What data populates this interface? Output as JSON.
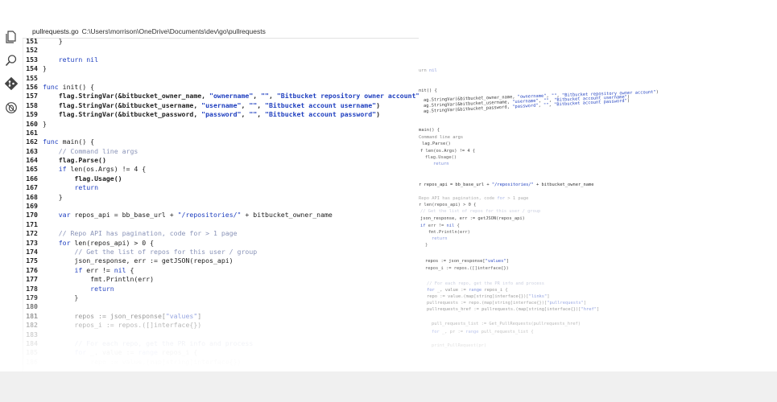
{
  "header": {
    "filename": "pullrequests.go",
    "path": "C:\\Users\\morrison\\OneDrive\\Documents\\dev\\go\\pullrequests"
  },
  "activity_bar": [
    "files-icon",
    "search-icon",
    "git-icon",
    "debug-icon"
  ],
  "colors": {
    "keyword": "#1f3fbf",
    "comment": "#8a94b8",
    "text": "#222222",
    "bottom_bar": "#f0f0f0"
  },
  "code_lines": [
    {
      "n": "151",
      "t": "    }"
    },
    {
      "n": "152",
      "t": ""
    },
    {
      "n": "153",
      "t": "    return nil"
    },
    {
      "n": "154",
      "t": "}"
    },
    {
      "n": "155",
      "t": ""
    },
    {
      "n": "156",
      "t": "func init() {"
    },
    {
      "n": "157",
      "t": "    flag.StringVar(&bitbucket_owner_name, \"ownername\", \"\", \"Bitbucket repository owner account\")"
    },
    {
      "n": "158",
      "t": "    flag.StringVar(&bitbucket_username, \"username\", \"\", \"Bitbucket account username\")"
    },
    {
      "n": "159",
      "t": "    flag.StringVar(&bitbucket_password, \"password\", \"\", \"Bitbucket account password\")"
    },
    {
      "n": "160",
      "t": "}"
    },
    {
      "n": "161",
      "t": ""
    },
    {
      "n": "162",
      "t": "func main() {"
    },
    {
      "n": "163",
      "t": "    // Command line args"
    },
    {
      "n": "164",
      "t": "    flag.Parse()"
    },
    {
      "n": "165",
      "t": "    if len(os.Args) != 4 {"
    },
    {
      "n": "166",
      "t": "        flag.Usage()"
    },
    {
      "n": "167",
      "t": "        return"
    },
    {
      "n": "168",
      "t": "    }"
    },
    {
      "n": "169",
      "t": ""
    },
    {
      "n": "170",
      "t": "    var repos_api = bb_base_url + \"/repositories/\" + bitbucket_owner_name"
    },
    {
      "n": "171",
      "t": ""
    },
    {
      "n": "172",
      "t": "    // Repo API has pagination, code for > 1 page"
    },
    {
      "n": "173",
      "t": "    for len(repos_api) > 0 {"
    },
    {
      "n": "174",
      "t": "        // Get the list of repos for this user / group"
    },
    {
      "n": "175",
      "t": "        json_response, err := getJSON(repos_api)"
    },
    {
      "n": "176",
      "t": "        if err != nil {"
    },
    {
      "n": "177",
      "t": "            fmt.Println(err)"
    },
    {
      "n": "178",
      "t": "            return"
    },
    {
      "n": "179",
      "t": "        }"
    },
    {
      "n": "180",
      "t": ""
    },
    {
      "n": "181",
      "t": "        repos := json_response[\"values\"]"
    },
    {
      "n": "182",
      "t": "        repos_i := repos.([]interface{})"
    },
    {
      "n": "183",
      "t": ""
    },
    {
      "n": "184",
      "t": "        // For each repo, get the PR info and process"
    },
    {
      "n": "185",
      "t": "        for _, value := range repos_i {"
    },
    {
      "n": "186",
      "t": "            repo := value.(map[string]interface{})"
    }
  ],
  "scattered_code": [
    "urn nil",
    "nit() {",
    "ag.StringVar(&bitbucket_owner_name, \"ownername\", \"\", \"Bitbucket repository owner account\")",
    "ag.StringVar(&bitbucket_username, \"username\", \"\", \"Bitbucket account username\")",
    "ag.StringVar(&bitbucket_password, \"password\", \"\", \"Bitbucket account password\")",
    "main() {",
    "Command line args",
    "lag.Parse()",
    "f len(os.Args) != 4 {",
    "flag.Usage()",
    "return",
    "r repos_api = bb_base_url + \"/repositories/\" + bitbucket_owner_name",
    "Repo API has pagination, code for > 1 page",
    "r len(repos_api) > 0 {",
    "// Get the list of repos for this user / group",
    "json_response, err := getJSON(repos_api)",
    "if err != nil {",
    "fmt.Println(err)",
    "return",
    "}",
    "repos := json_response[\"values\"]",
    "repos_i := repos.([]interface{})",
    "// For each repo, get the PR info and process",
    "for _, value := range repos_i {",
    "repo := value.(map[string]interface{})[\"links\"]",
    "pullrequests := repo.(map[string]interface{})[\"pullrequests\"]",
    "pullrequests_href := pullrequests.(map[string]interface{})[\"href\"]",
    "pull_requests_list := Get_PullRequests(pullrequests_href)",
    "for _, pr := range pull_requests_list {",
    "print_PullRequest(pr)"
  ]
}
